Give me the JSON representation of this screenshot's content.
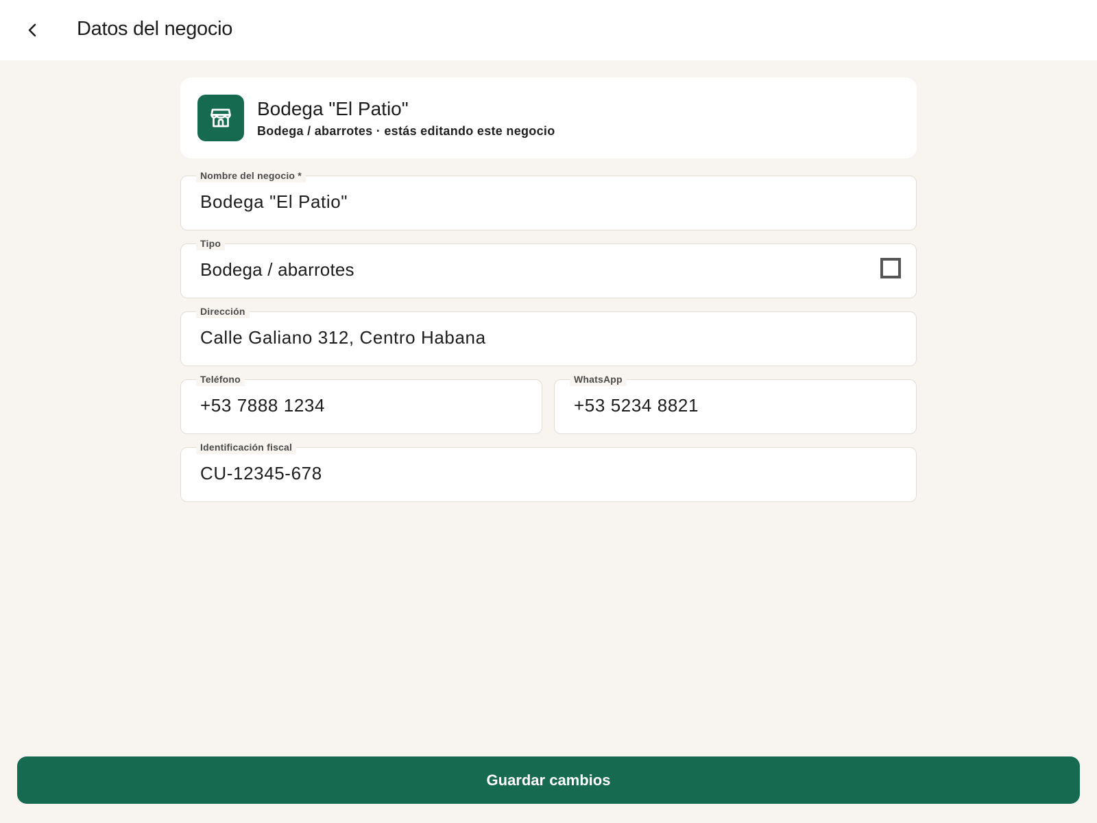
{
  "header": {
    "back_icon": "chevron-left-icon",
    "title": "Datos del negocio"
  },
  "business": {
    "icon": "store-icon",
    "name": "Bodega \"El Patio\"",
    "subtitle": "Bodega / abarrotes · estás editando este negocio"
  },
  "form": {
    "name": {
      "label": "Nombre del negocio *",
      "value": "Bodega \"El Patio\""
    },
    "type": {
      "label": "Tipo",
      "value": "Bodega / abarrotes",
      "icon": "dropdown-square-icon"
    },
    "address": {
      "label": "Dirección",
      "value": "Calle Galiano 312, Centro Habana"
    },
    "phone": {
      "label": "Teléfono",
      "value": "+53 7888 1234"
    },
    "whatsapp": {
      "label": "WhatsApp",
      "value": "+53 5234 8821"
    },
    "tax_id": {
      "label": "Identificación fiscal",
      "value": "CU-12345-678"
    }
  },
  "actions": {
    "save_label": "Guardar cambios"
  },
  "colors": {
    "accent": "#166a50",
    "background": "#f8f5f0",
    "surface": "#ffffff"
  }
}
